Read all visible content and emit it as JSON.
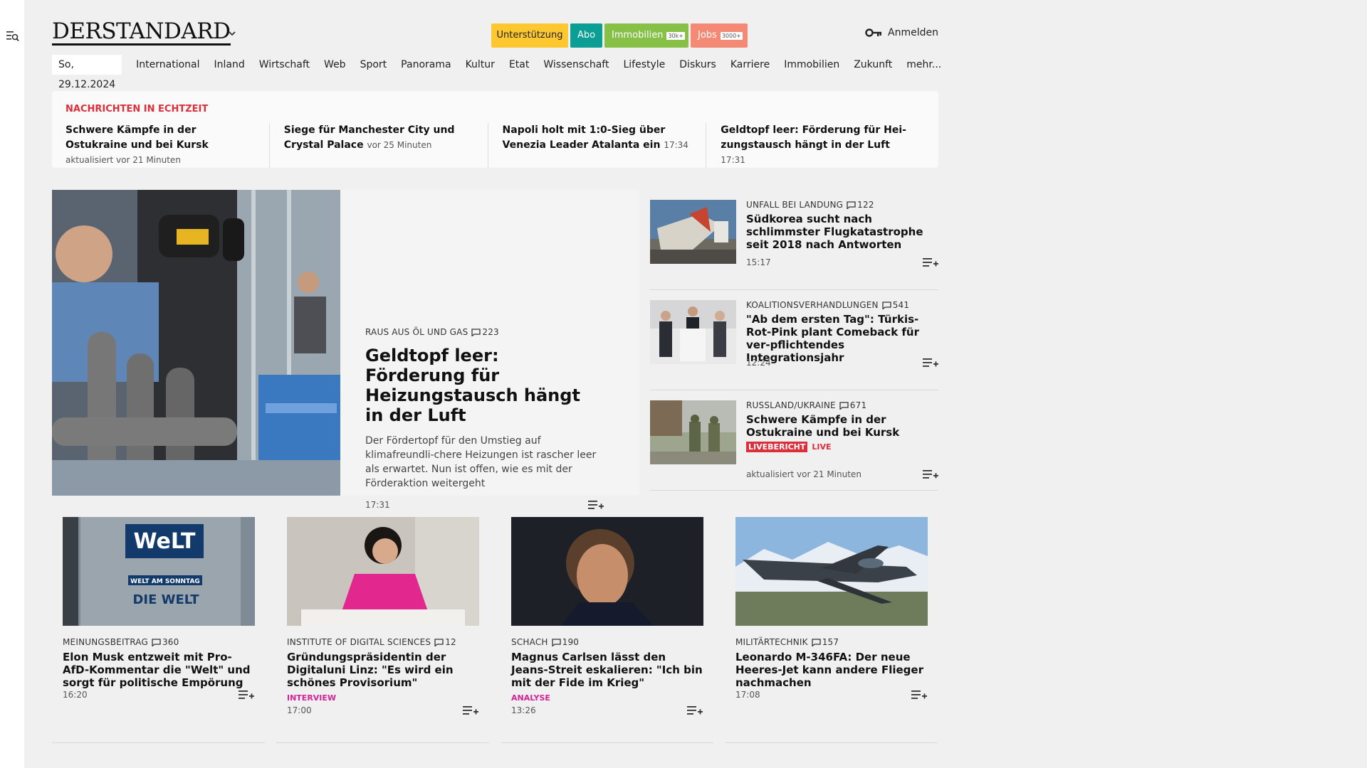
{
  "header": {
    "logo": "DERSTANDARD",
    "buttons": {
      "support": "Unterstützung",
      "abo": "Abo",
      "immobilien": "Immobilien",
      "immobilien_tag": "30k+",
      "jobs": "Jobs",
      "jobs_tag": "3000+"
    },
    "login": "Anmelden"
  },
  "nav": {
    "date": "So, 29.12.2024",
    "items": [
      "International",
      "Inland",
      "Wirtschaft",
      "Web",
      "Sport",
      "Panorama",
      "Kultur",
      "Etat",
      "Wissenschaft",
      "Lifestyle",
      "Diskurs",
      "Karriere",
      "Immobilien",
      "Zukunft",
      "mehr..."
    ]
  },
  "ticker": {
    "title": "NACHRICHTEN IN ECHTZEIT",
    "items": [
      {
        "headline": "Schwere Kämpfe in der Ostukraine und bei Kursk",
        "meta": "aktualisiert vor 21 Minuten"
      },
      {
        "headline": "Siege für Manchester City und Crystal Palace",
        "meta": "vor 25 Minuten"
      },
      {
        "headline": "Napoli holt mit 1:0-Sieg über Venezia Leader Atalanta ein",
        "meta": "17:34"
      },
      {
        "headline": "Geldtopf leer: Förderung für Hei-zungstausch hängt in der Luft",
        "meta": "17:31"
      }
    ]
  },
  "hero": {
    "kicker": "RAUS AUS ÖL UND GAS",
    "comments": "223",
    "headline": "Geldtopf leer: Förderung für Heizungstausch hängt in der Luft",
    "teaser": "Der Fördertopf für den Umstieg auf klimafreundli-chere Heizungen ist rascher leer als erwartet. Nun ist offen, wie es mit der Förderaktion weitergeht",
    "time": "17:31"
  },
  "side": [
    {
      "kicker": "UNFALL BEI LANDUNG",
      "comments": "122",
      "headline": "Südkorea sucht nach schlimmster Flugkatastrophe seit 2018 nach Antworten",
      "time": "15:17"
    },
    {
      "kicker": "KOALITIONSVERHANDLUNGEN",
      "comments": "541",
      "headline": "\"Ab dem ersten Tag\": Türkis-Rot-Pink plant Comeback für ver-pflichtendes Integrationsjahr",
      "time": "12:24"
    },
    {
      "kicker": "RUSSLAND/UKRAINE",
      "comments": "671",
      "headline": "Schwere Kämpfe in der Ostukraine und bei Kursk",
      "live_badge": "LIVEBERICHT",
      "live": "LIVE",
      "time": "aktualisiert vor 21 Minuten"
    }
  ],
  "cards": [
    {
      "kicker": "MEINUNGSBEITRAG",
      "comments": "360",
      "headline": "Elon Musk entzweit mit Pro-AfD-Kommentar die \"Welt\" und sorgt für politische Empörung",
      "label": "",
      "time": "16:20"
    },
    {
      "kicker": "INSTITUTE OF DIGITAL SCIENCES",
      "comments": "12",
      "headline": "Gründungspräsidentin der Digitaluni Linz: \"Es wird ein schönes Provisorium\"",
      "label": "INTERVIEW",
      "time": "17:00"
    },
    {
      "kicker": "SCHACH",
      "comments": "190",
      "headline": "Magnus Carlsen lässt den Jeans-Streit eskalieren: \"Ich bin mit der Fide im Krieg\"",
      "label": "ANALYSE",
      "time": "13:26"
    },
    {
      "kicker": "MILITÄRTECHNIK",
      "comments": "157",
      "headline": "Leonardo M-346FA: Der neue Heeres-Jet kann andere Flieger nachmachen",
      "label": "",
      "time": "17:08"
    }
  ],
  "image_text": {
    "welt_sign": "WeLT",
    "welt_am_sonntag": "WELT AM SONNTAG",
    "die_welt": "DIE WELT"
  },
  "colors": {
    "support": "#fdc72f",
    "abo": "#0a9e95",
    "immobilien": "#86c047",
    "jobs": "#f48a75",
    "ticker_title": "#dc2f3b",
    "live": "#dc2f3b",
    "label": "#d42399"
  }
}
